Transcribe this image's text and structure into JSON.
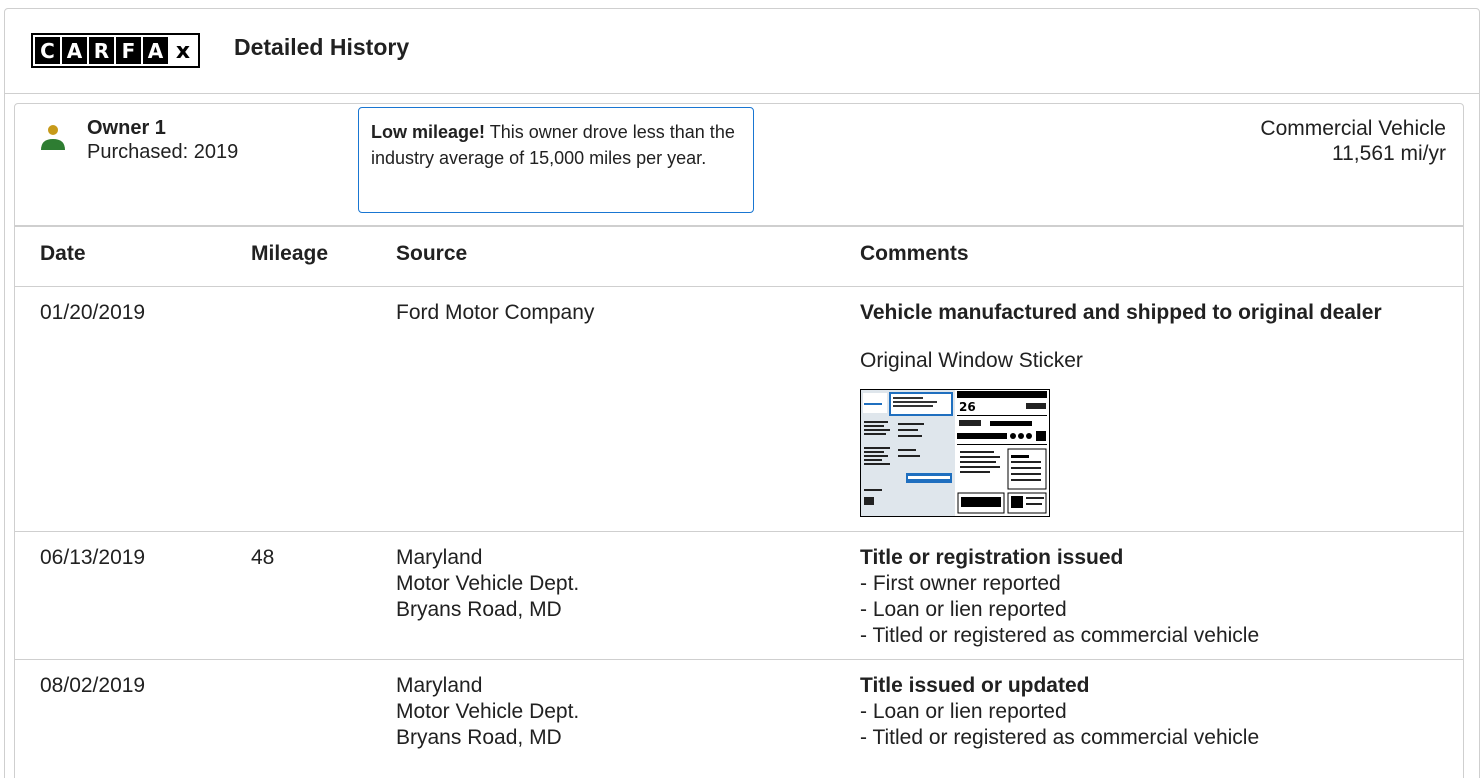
{
  "header": {
    "logo": {
      "letters": [
        "C",
        "A",
        "R",
        "F",
        "A",
        "x"
      ]
    },
    "title": "Detailed History"
  },
  "owner": {
    "icon": "person-icon",
    "name": "Owner 1",
    "purchased": "Purchased: 2019",
    "callout_bold": "Low mileage!",
    "callout_text": " This owner drove less than the industry average of 15,000 miles per year.",
    "vehicle_type": "Commercial Vehicle",
    "mileage_rate": "11,561 mi/yr"
  },
  "colors": {
    "accent": "#1976d2",
    "owner_head": "#c79a1a",
    "owner_body": "#2e7d32",
    "border": "#cfcfcf"
  },
  "table": {
    "headers": {
      "date": "Date",
      "mileage": "Mileage",
      "source": "Source",
      "comments": "Comments"
    },
    "rows": [
      {
        "date": "01/20/2019",
        "mileage": "",
        "source": [
          "Ford Motor Company"
        ],
        "title": "Vehicle manufactured and shipped to original dealer",
        "items": [],
        "sticker_label": "Original Window Sticker",
        "sticker_icon": "window-sticker-thumbnail"
      },
      {
        "date": "06/13/2019",
        "mileage": "48",
        "source": [
          "Maryland",
          "Motor Vehicle Dept.",
          "Bryans Road, MD"
        ],
        "title": "Title or registration issued",
        "items": [
          "- First owner reported",
          "- Loan or lien reported",
          "- Titled or registered as commercial vehicle"
        ]
      },
      {
        "date": "08/02/2019",
        "mileage": "",
        "source": [
          "Maryland",
          "Motor Vehicle Dept.",
          "Bryans Road, MD"
        ],
        "title": "Title issued or updated",
        "items": [
          "- Loan or lien reported",
          "- Titled or registered as commercial vehicle"
        ]
      }
    ]
  }
}
